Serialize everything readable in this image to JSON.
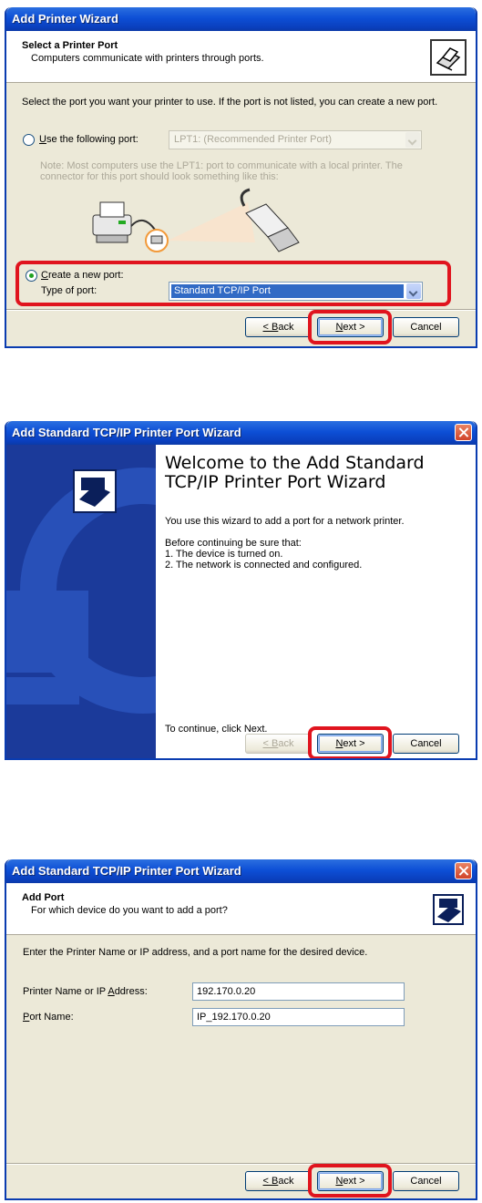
{
  "dialog1": {
    "title": "Add Printer Wizard",
    "header_title": "Select a Printer Port",
    "header_sub": "Computers communicate with printers through ports.",
    "intro": "Select the port you want your printer to use.  If the port is not listed, you can create a new port.",
    "use_port_label": "Use the following port:",
    "use_port_value": "LPT1: (Recommended Printer Port)",
    "note": "Note: Most computers use the LPT1: port to communicate with a local printer. The connector for this port should look something like this:",
    "create_port_label": "Create a new port:",
    "type_label": "Type of port:",
    "type_value": "Standard TCP/IP Port",
    "back": "< Back",
    "next": "Next >",
    "cancel": "Cancel"
  },
  "dialog2": {
    "title": "Add Standard TCP/IP Printer Port Wizard",
    "heading": "Welcome to the Add Standard TCP/IP Printer Port Wizard",
    "p1": "You use this wizard to add a port for a network printer.",
    "p2": "Before continuing be sure that:",
    "p3": "1.  The device is turned on.",
    "p4": "2.  The network is connected and configured.",
    "p5": "To continue, click Next.",
    "back": "< Back",
    "next": "Next >",
    "cancel": "Cancel"
  },
  "dialog3": {
    "title": "Add Standard TCP/IP Printer Port Wizard",
    "header_title": "Add Port",
    "header_sub": "For which device do you want to add a port?",
    "intro": "Enter the Printer Name or IP address, and a port name for the desired device.",
    "printer_label": "Printer Name or IP Address:",
    "printer_value": "192.170.0.20",
    "port_label": "Port Name:",
    "port_value": "IP_192.170.0.20",
    "back": "< Back",
    "next": "Next >",
    "cancel": "Cancel"
  },
  "colors": {
    "titlebar": "#0d4fd6",
    "highlight": "#e0141e",
    "selection": "#316ac5"
  },
  "icons": [
    "printer-icon",
    "close-icon",
    "dropdown-arrow-icon",
    "printer-cable-illustration"
  ]
}
